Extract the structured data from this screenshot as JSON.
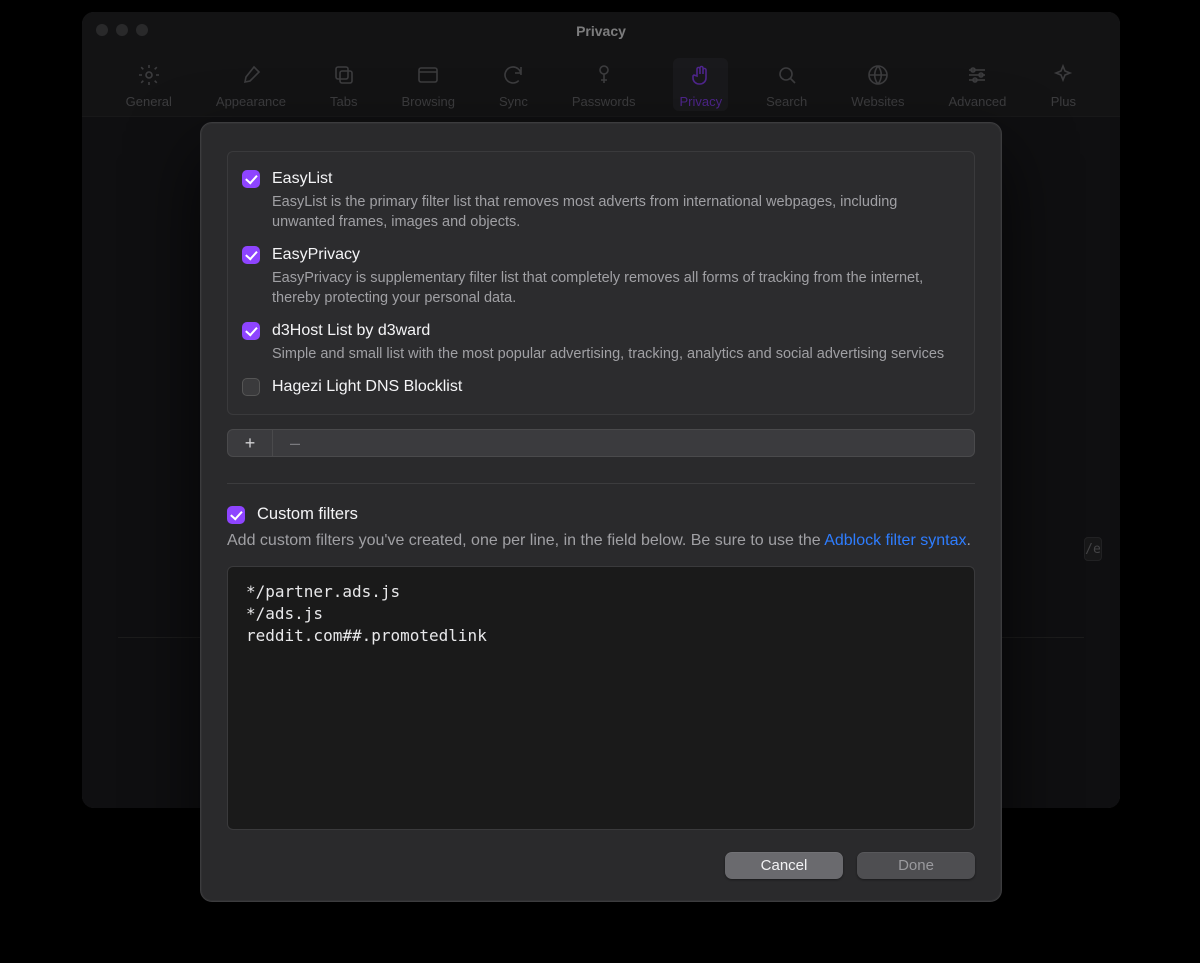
{
  "window": {
    "title": "Privacy",
    "bg_chip": "/e"
  },
  "toolbar": {
    "items": [
      {
        "id": "general",
        "label": "General"
      },
      {
        "id": "appearance",
        "label": "Appearance"
      },
      {
        "id": "tabs",
        "label": "Tabs"
      },
      {
        "id": "browsing",
        "label": "Browsing"
      },
      {
        "id": "sync",
        "label": "Sync"
      },
      {
        "id": "passwords",
        "label": "Passwords"
      },
      {
        "id": "privacy",
        "label": "Privacy",
        "active": true
      },
      {
        "id": "search",
        "label": "Search"
      },
      {
        "id": "websites",
        "label": "Websites"
      },
      {
        "id": "advanced",
        "label": "Advanced"
      },
      {
        "id": "plus",
        "label": "Plus"
      }
    ]
  },
  "sheet": {
    "filters": [
      {
        "name": "EasyList",
        "desc": "EasyList is the primary filter list that removes most adverts from international webpages, including unwanted frames, images and objects.",
        "checked": true
      },
      {
        "name": "EasyPrivacy",
        "desc": "EasyPrivacy is supplementary filter list that completely removes all forms of tracking from the internet, thereby protecting your personal data.",
        "checked": true
      },
      {
        "name": "d3Host List by d3ward",
        "desc": "Simple and small list with the most popular advertising, tracking, analytics and social advertising services",
        "checked": true
      },
      {
        "name": "Hagezi Light DNS Blocklist",
        "desc": "",
        "checked": false
      }
    ],
    "add_label": "+",
    "remove_label": "–",
    "custom": {
      "enabled": true,
      "title": "Custom filters",
      "desc_before": "Add custom filters you've created, one per line, in the field below. Be sure to use the ",
      "link": "Adblock filter syntax",
      "desc_after": ".",
      "code": "*/partner.ads.js\n*/ads.js\nreddit.com##.promotedlink"
    },
    "buttons": {
      "cancel": "Cancel",
      "done": "Done"
    }
  }
}
